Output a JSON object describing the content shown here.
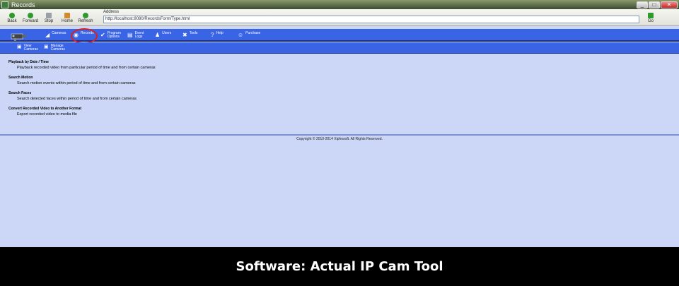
{
  "window": {
    "title": "Records",
    "controls": [
      "_",
      "□",
      "✕"
    ]
  },
  "toolbar": {
    "buttons": [
      {
        "label": "Back",
        "icon": "back-arrow-icon",
        "color": "#2e9a2e"
      },
      {
        "label": "Forward",
        "icon": "forward-arrow-icon",
        "color": "#2e9a2e"
      },
      {
        "label": "Stop",
        "icon": "stop-icon",
        "color": "#9aa0a8"
      },
      {
        "label": "Home",
        "icon": "home-icon",
        "color": "#d48a2a"
      },
      {
        "label": "Refresh",
        "icon": "refresh-icon",
        "color": "#2e9a2e"
      }
    ],
    "address_label": "Address",
    "address_value": "http://localhost:8080/RecordsForm/Type.html",
    "go_label": "Go"
  },
  "nav": {
    "items": [
      {
        "label": "Cameras",
        "icon": "camera-icon"
      },
      {
        "label": "Records",
        "icon": "records-icon"
      },
      {
        "label": "Program Options",
        "icon": "checkmark-icon"
      },
      {
        "label": "Event Logs",
        "icon": "document-icon"
      },
      {
        "label": "Users",
        "icon": "users-icon"
      },
      {
        "label": "Tools",
        "icon": "tools-icon"
      },
      {
        "label": "Help",
        "icon": "help-icon"
      },
      {
        "label": "Purchase",
        "icon": "purchase-icon"
      }
    ],
    "highlight_color": "#d8211f"
  },
  "subnav": {
    "items": [
      {
        "label": "View Cameras",
        "icon": "view-cameras-icon"
      },
      {
        "label": "Manage Cameras",
        "icon": "manage-cameras-icon"
      }
    ]
  },
  "sections": [
    {
      "title": "Playback by Date / Time",
      "desc": "Playback recorded video from particular period of time and from certain cameras"
    },
    {
      "title": "Search Motion",
      "desc": "Search motion events within period of time and from certain cameras"
    },
    {
      "title": "Search Faces",
      "desc": "Search detected faces within period of time and from certain cameras"
    },
    {
      "title": "Convert Recorded Video to Another Format",
      "desc": "Export recorded video to media file"
    }
  ],
  "footer": {
    "copyright": "Copyright © 2010-2014 Xiphosoft. All Rights Reserved."
  },
  "caption": {
    "text": "Software: Actual IP Cam Tool"
  }
}
